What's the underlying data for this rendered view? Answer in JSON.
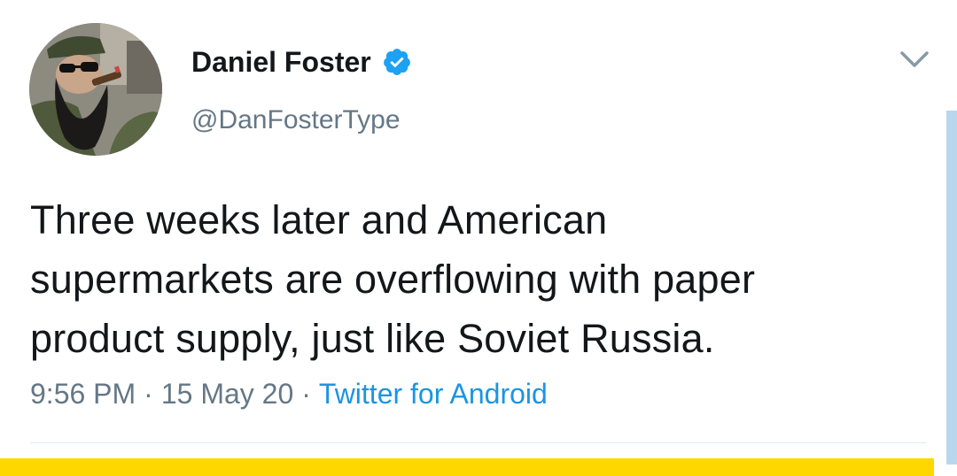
{
  "tweet": {
    "author": {
      "display_name": "Daniel Foster",
      "handle": "@DanFosterType",
      "verified": true
    },
    "text_lines": [
      "Three weeks later and American",
      "supermarkets are overflowing with paper",
      "product supply, just like Soviet Russia."
    ],
    "time": "9:56 PM",
    "date": "15 May 20",
    "source": "Twitter for Android",
    "separator": "·"
  },
  "icons": {
    "verified": "verified-badge-icon",
    "menu": "chevron-down-icon"
  },
  "colors": {
    "text": "#14171a",
    "secondary": "#657786",
    "link": "#1b95e0",
    "verified": "#1da1f2",
    "highlight_bar": "#ffd700"
  }
}
